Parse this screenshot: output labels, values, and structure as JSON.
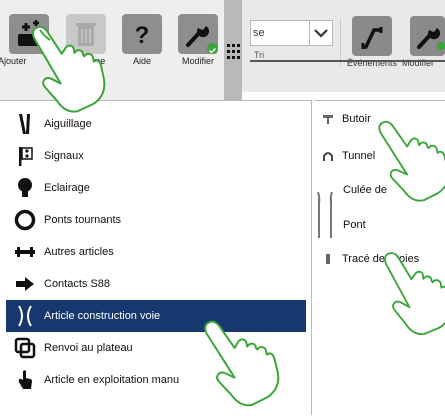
{
  "toolbar": {
    "buttons": [
      {
        "name": "ajouter",
        "label": "Ajouter",
        "icon": "add-track-icon"
      },
      {
        "name": "supprime",
        "label": "Supprime",
        "icon": "trash-icon"
      },
      {
        "name": "aide",
        "label": "Aide",
        "icon": "help-icon"
      },
      {
        "name": "modifier",
        "label": "Modifier",
        "icon": "wrench-icon"
      }
    ]
  },
  "background_toolbar": {
    "combo_value": "se",
    "combo_sub": "Tri",
    "buttons": [
      {
        "label": "Événements",
        "icon": "event-curve-icon"
      },
      {
        "label": "Modifier",
        "icon": "wrench-icon"
      }
    ]
  },
  "left_menu": {
    "items": [
      {
        "label": "Aiguillage",
        "icon": "turnout-icon"
      },
      {
        "label": "Signaux",
        "icon": "signal-icon"
      },
      {
        "label": "Eclairage",
        "icon": "lamp-icon"
      },
      {
        "label": "Ponts tournants",
        "icon": "turntable-icon"
      },
      {
        "label": "Autres articles",
        "icon": "other-articles-icon"
      },
      {
        "label": "Contacts S88",
        "icon": "contact-arrow-icon"
      },
      {
        "label": "Article construction voie",
        "icon": "track-construction-icon"
      },
      {
        "label": "Renvoi au plateau",
        "icon": "link-icon"
      },
      {
        "label": "Article en exploitation manu",
        "icon": "hand-pointer-icon"
      }
    ],
    "selected_index": 6
  },
  "right_menu": {
    "items": [
      {
        "label": "Butoir",
        "icon": "buffer-stop-icon"
      },
      {
        "label": "Tunnel",
        "icon": "tunnel-icon"
      },
      {
        "label": "Culée de",
        "icon": "abutment-icon"
      },
      {
        "label": "Pont",
        "icon": "bridge-icon"
      },
      {
        "label": "Tracé des voies",
        "icon": "track-line-icon"
      }
    ]
  },
  "colors": {
    "selection": "#16386e",
    "accent_green": "#3aa63a",
    "hand_outline": "#3aa63a"
  }
}
